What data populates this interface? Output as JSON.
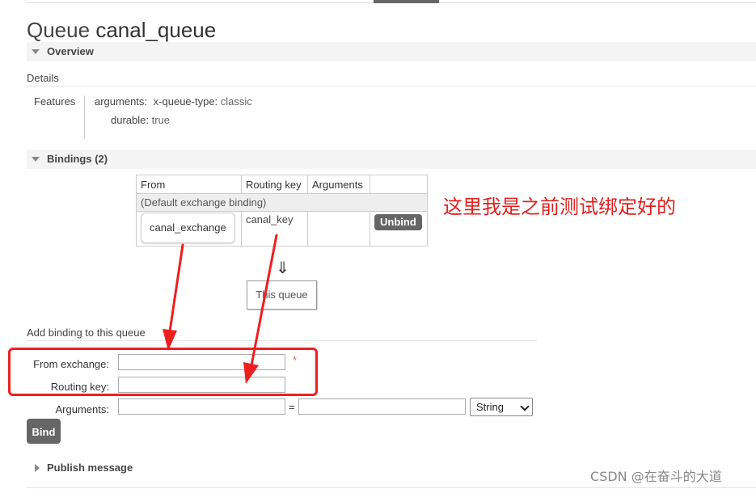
{
  "queue": {
    "title_prefix": "Queue",
    "name": "canal_queue"
  },
  "overview": {
    "title": "Overview",
    "details_label": "Details",
    "features_label": "Features",
    "features": [
      {
        "key": "arguments:",
        "subkey": "x-queue-type:",
        "value": "classic"
      },
      {
        "key": "durable:",
        "value": "true"
      }
    ]
  },
  "bindings": {
    "title": "Bindings (2)",
    "columns": [
      "From",
      "Routing key",
      "Arguments",
      ""
    ],
    "default_row": "(Default exchange binding)",
    "rows": [
      {
        "from": "canal_exchange",
        "routing_key": "canal_key",
        "arguments": "",
        "action": "Unbind"
      }
    ],
    "down_arrow": "⇓",
    "this_queue": "This queue"
  },
  "add_binding": {
    "title": "Add binding to this queue",
    "from_label": "From exchange:",
    "from_value": "",
    "required_mark": "*",
    "routing_label": "Routing key:",
    "routing_value": "",
    "arguments_label": "Arguments:",
    "arg_key": "",
    "equals": "=",
    "arg_value": "",
    "type_selected": "String",
    "bind_label": "Bind"
  },
  "publish": {
    "title": "Publish message"
  },
  "annotation": {
    "text": "这里我是之前测试绑定好的",
    "color": "#e0201e"
  },
  "watermark": "CSDN @在奋斗的大道"
}
